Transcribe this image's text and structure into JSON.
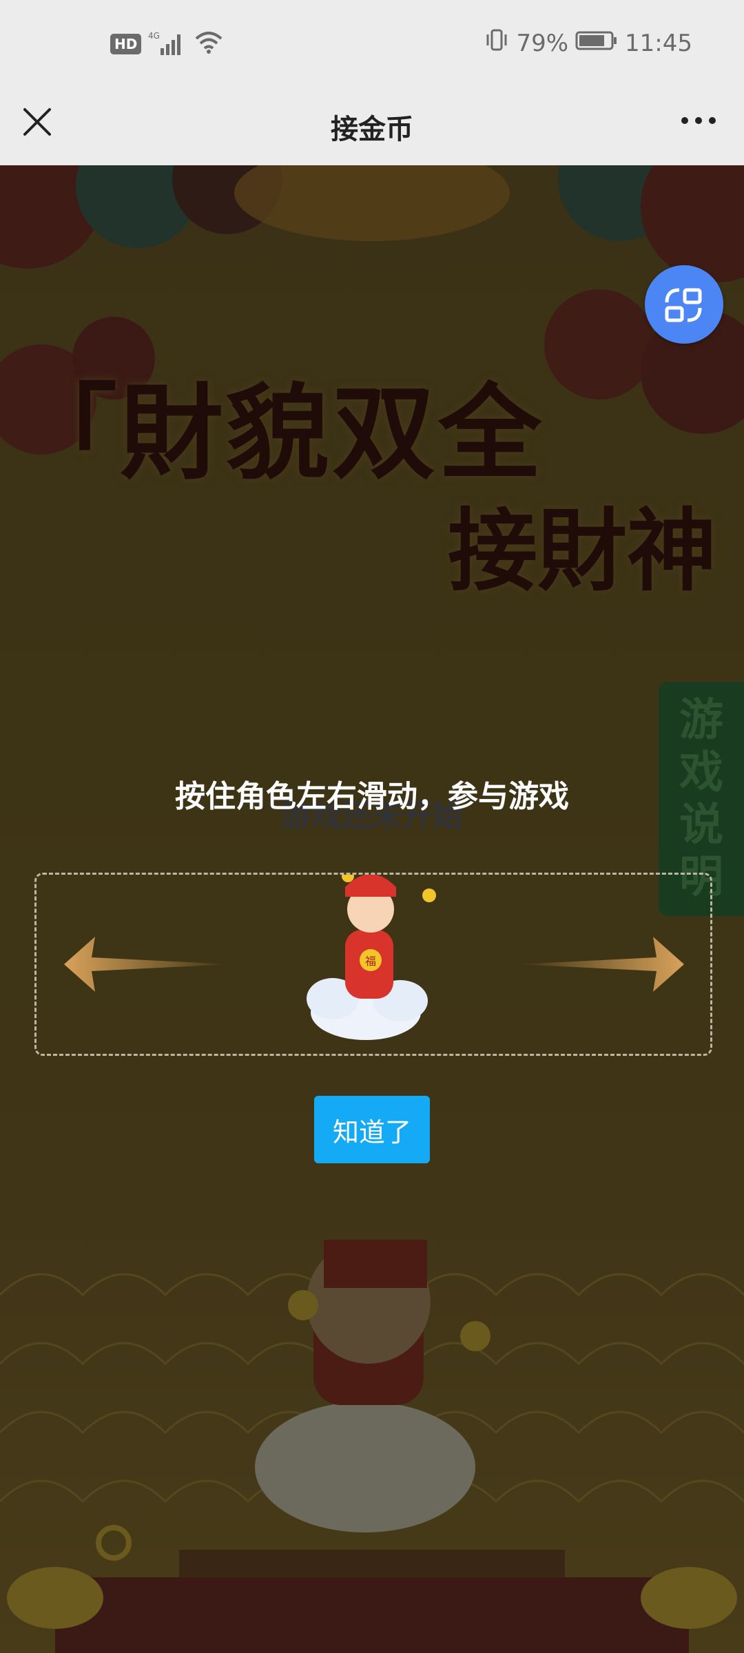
{
  "status_bar": {
    "hd": "HD",
    "network": "4G",
    "battery": "79%",
    "time": "11:45"
  },
  "nav": {
    "title": "接金币"
  },
  "game": {
    "title_line1": "「財貌双全",
    "title_line2": "接財神",
    "instruction": "按住角色左右滑动，参与游戏",
    "ghost_text": "游戏还未开始",
    "rules_tab": "游戏说明",
    "got_it": "知道了",
    "character_badge": "福"
  },
  "icons": [
    "close-icon",
    "more-icon",
    "switch-screen-icon",
    "left-arrow-icon",
    "right-arrow-icon"
  ],
  "colors": {
    "accent_blue": "#14aaf5",
    "fab_blue": "#4c86f5",
    "overlay_bg": "#3d3315"
  }
}
